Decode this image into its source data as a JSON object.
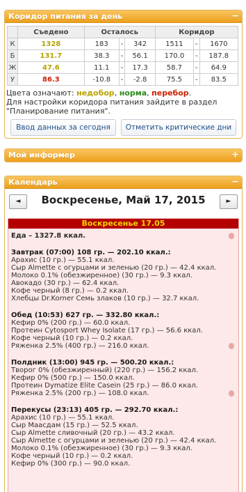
{
  "corridor": {
    "title": "Коридор питания за день",
    "toggle": "−",
    "headers": [
      "Съедено",
      "Осталось",
      "Коридор"
    ],
    "rows": [
      {
        "label": "К",
        "eaten": "1328",
        "status": "under",
        "rem_min": "183",
        "rem_max": "342",
        "cor_min": "1511",
        "cor_max": "1670"
      },
      {
        "label": "Б",
        "eaten": "131.7",
        "status": "under",
        "rem_min": "38.3",
        "rem_max": "56.1",
        "cor_min": "170.0",
        "cor_max": "187.8"
      },
      {
        "label": "Ж",
        "eaten": "47.6",
        "status": "under",
        "rem_min": "11.1",
        "rem_max": "17.3",
        "cor_min": "58.7",
        "cor_max": "64.9"
      },
      {
        "label": "У",
        "eaten": "86.3",
        "status": "over",
        "rem_min": "-10.8",
        "rem_max": "-2.8",
        "cor_min": "75.5",
        "cor_max": "83.5"
      }
    ],
    "dash": "-",
    "legend_prefix": "Цвета означают: ",
    "legend_under": "недобор",
    "legend_ok": "норма",
    "legend_over": "перебор",
    "legend_sep": ", ",
    "legend_end": ".",
    "hint": "Для настройки коридора питания зайдите в раздел \"Планирование питания\".",
    "btn_today": "Ввод данных за сегодня",
    "btn_critical": "Отметить критические дни"
  },
  "informer": {
    "title": "Мой информер",
    "toggle": "+"
  },
  "calendar": {
    "title": "Календарь",
    "toggle": "−",
    "prev": "◄",
    "next": "►",
    "date": "Воскресенье, Май 17, 2015",
    "day_label": "Воскресенье 17.05",
    "total": "Еда – 1327.8 ккал.",
    "meals": [
      {
        "title": "Завтрак (07:00) 108 гр. — 202.10 ккал.:",
        "items": [
          "Арахис (10 гр.) — 55.1 ккал.",
          "Сыр Almette с огурцами и зеленью (20 гр.) — 42.4 ккал.",
          "Молоко 0.1% (обезжиренное) (30 гр.) — 9.3 ккал.",
          "Авокадо (30 гр.) — 62.4 ккал.",
          "Кофе черный (8 гр.) — 0.2 ккал.",
          "Хлебцы Dr.Korner Семь злаков (10 гр.) — 32.7 ккал."
        ]
      },
      {
        "title": "Обед (10:53) 627 гр. — 332.80 ккал.:",
        "items": [
          "Кефир 0% (200 гр.) — 60.0 ккал.",
          "Протеин Cytosport Whey Isolate (17 гр.) — 56.6 ккал.",
          "Кофе черный (10 гр.) — 0.2 ккал.",
          "Ряженка 2.5% (400 гр.) — 216.0 ккал."
        ]
      },
      {
        "title": "Полдник (13:00) 945 гр. — 500.20 ккал.:",
        "items": [
          "Творог 0% (обезжиренный) (220 гр.) — 156.2 ккал.",
          "Кефир 0% (500 гр.) — 150.0 ккал.",
          "Протеин Dymatize Elite Casein (25 гр.) — 86.0 ккал.",
          "Ряженка 2.5% (200 гр.) — 108.0 ккал."
        ]
      },
      {
        "title": "Перекусы (23:13) 405 гр. — 292.70 ккал.:",
        "items": [
          "Арахис (10 гр.) — 55.1 ккал.",
          "Сыр Маасдам (15 гр.) — 52.5 ккал.",
          "Сыр Almette сливочный (20 гр.) — 43.2 ккал.",
          "Сыр Almette с огурцами и зеленью (20 гр.) — 42.4 ккал.",
          "Молоко 0.1% (обезжиренное) (30 гр.) — 9.3 ккал.",
          "Кофе черный (10 гр.) — 0.2 ккал.",
          "Кефир 0% (300 гр.) — 90.0 ккал."
        ]
      }
    ]
  },
  "colors": {
    "under": "#b8a200",
    "ok": "#2a8a1a",
    "over": "#cc1f00",
    "header": "#ec9f1c",
    "day_bg": "#fde9e9"
  },
  "icons": {
    "apple": "apple-icon"
  }
}
